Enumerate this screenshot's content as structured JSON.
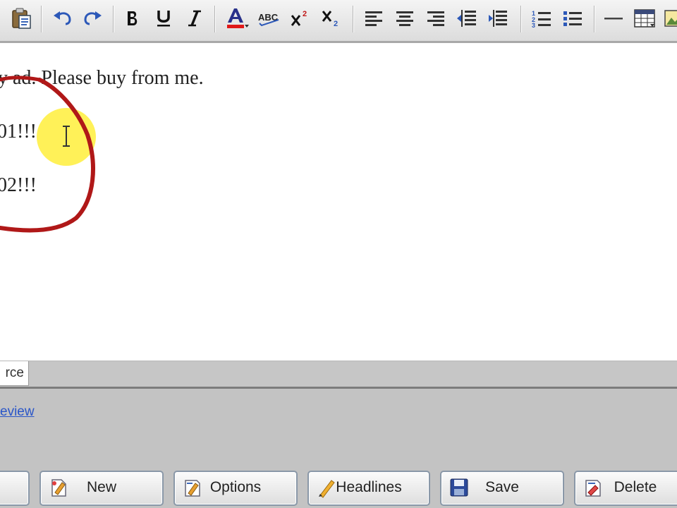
{
  "editor": {
    "lines": [
      "y ad. Please buy from me.",
      "01!!!",
      "02!!!"
    ]
  },
  "tabs": [
    {
      "label": "rce"
    }
  ],
  "lower_panel": {
    "preview_link": "eview"
  },
  "action_buttons": [
    {
      "label": "New",
      "icon": "new-icon"
    },
    {
      "label": "Options",
      "icon": "options-icon"
    },
    {
      "label": "Headlines",
      "icon": "headlines-icon"
    },
    {
      "label": "Save",
      "icon": "save-icon"
    },
    {
      "label": "Delete",
      "icon": "delete-icon"
    }
  ],
  "colors": {
    "annotation": "#b01818",
    "highlight": "#fff046",
    "link": "#2a56c8"
  }
}
